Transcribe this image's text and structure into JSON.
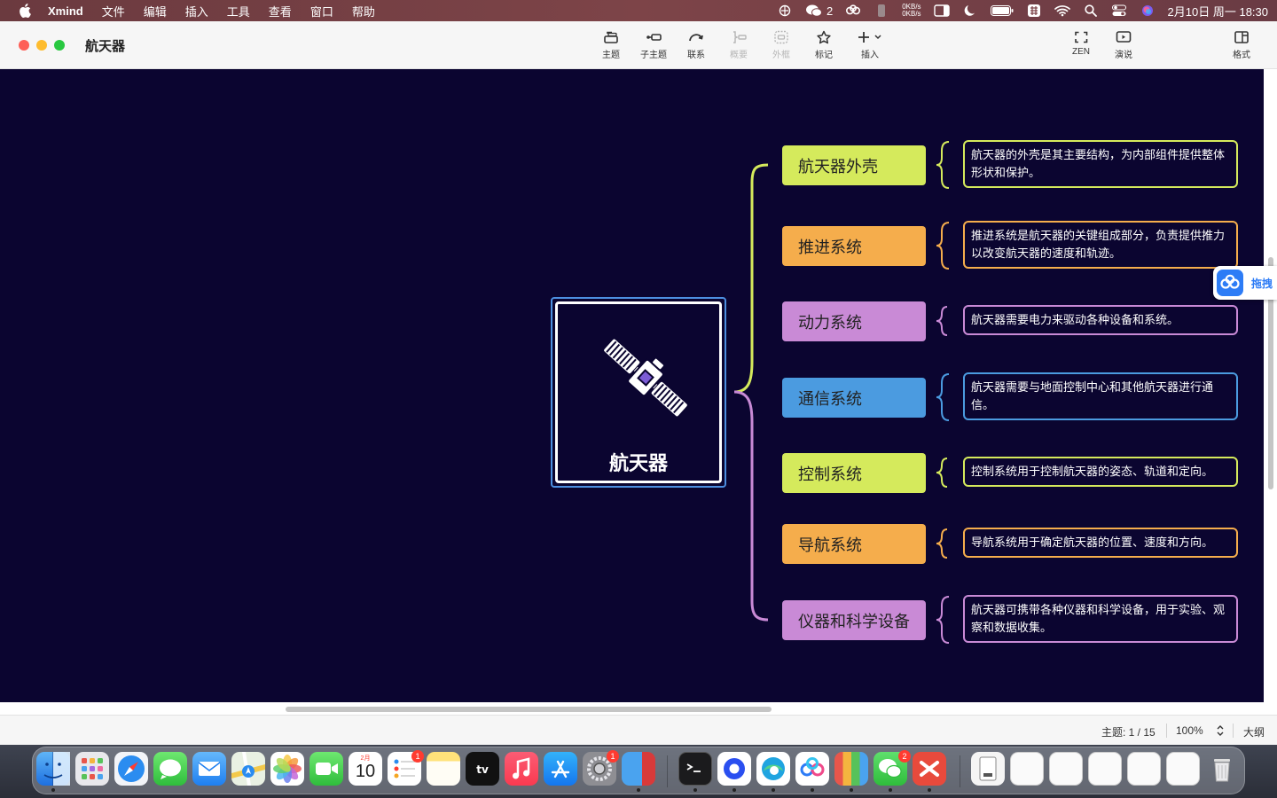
{
  "menubar": {
    "app_name": "Xmind",
    "menus": [
      "文件",
      "编辑",
      "插入",
      "工具",
      "查看",
      "窗口",
      "帮助"
    ],
    "wechat_count": "2",
    "net_up": "0KB/s",
    "net_down": "0KB/s",
    "clock": "2月10日 周一 18:30"
  },
  "window": {
    "title": "航天器",
    "toolbar": {
      "topic": "主题",
      "subtopic": "子主题",
      "relationship": "联系",
      "summary": "概要",
      "boundary": "外框",
      "marker": "标记",
      "insert": "插入",
      "zen": "ZEN",
      "pitch": "演说",
      "format": "格式"
    }
  },
  "mindmap": {
    "central": "航天器",
    "branches": [
      {
        "label": "航天器外壳",
        "note": "航天器的外壳是其主要结构，为内部组件提供整体形状和保护。",
        "color": "#d5ea5c"
      },
      {
        "label": "推进系统",
        "note": "推进系统是航天器的关键组成部分，负责提供推力以改变航天器的速度和轨迹。",
        "color": "#f5ad4c"
      },
      {
        "label": "动力系统",
        "note": "航天器需要电力来驱动各种设备和系统。",
        "color": "#c98ad6"
      },
      {
        "label": "通信系统",
        "note": "航天器需要与地面控制中心和其他航天器进行通信。",
        "color": "#4b9be0"
      },
      {
        "label": "控制系统",
        "note": "控制系统用于控制航天器的姿态、轨道和定向。",
        "color": "#d5ea5c"
      },
      {
        "label": "导航系统",
        "note": "导航系统用于确定航天器的位置、速度和方向。",
        "color": "#f5ad4c"
      },
      {
        "label": "仪器和科学设备",
        "note": "航天器可携带各种仪器和科学设备，用于实验、观察和数据收集。",
        "color": "#c98ad6"
      }
    ]
  },
  "floating_button": {
    "label": "拖拽"
  },
  "statusbar": {
    "topics": "主题: 1 / 15",
    "zoom": "100%",
    "outline": "大纲"
  },
  "dock": {
    "calendar_month": "2月",
    "calendar_day": "10",
    "badges": {
      "reminders": "1",
      "settings": "1",
      "wechat": "2"
    }
  }
}
